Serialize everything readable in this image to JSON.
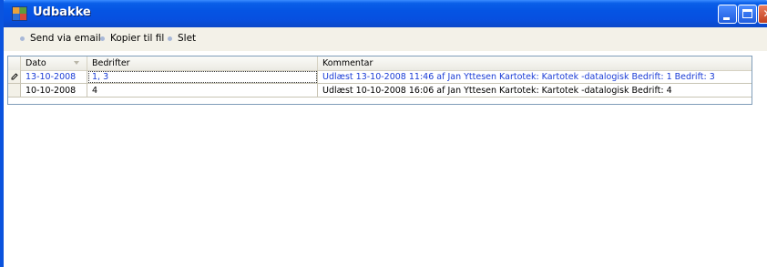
{
  "window": {
    "title": "Udbakke",
    "buttons": {
      "minimize": "minimize",
      "maximize": "maximize",
      "close": "close"
    }
  },
  "toolbar": {
    "items": [
      {
        "label": "Send via email",
        "icon": "bullet-icon"
      },
      {
        "label": "Kopier til fil",
        "icon": "bullet-icon"
      },
      {
        "label": "Slet",
        "icon": "bullet-icon"
      }
    ]
  },
  "grid": {
    "columns": [
      "Dato",
      "Bedrifter",
      "Kommentar"
    ],
    "rows": [
      {
        "dato": "13-10-2008",
        "bedrifter": "1, 3",
        "kommentar": "Udlæst 13-10-2008 11:46 af Jan Yttesen Kartotek: Kartotek -datalogisk Bedrift: 1 Bedrift: 3",
        "active": true
      },
      {
        "dato": "10-10-2008",
        "bedrifter": "4",
        "kommentar": "Udlæst 10-10-2008 16:06 af Jan Yttesen Kartotek: Kartotek -datalogisk Bedrift: 4",
        "active": false
      }
    ]
  },
  "colors": {
    "titlebar": "#0554e3",
    "active_row_text": "#1a3cd6"
  }
}
